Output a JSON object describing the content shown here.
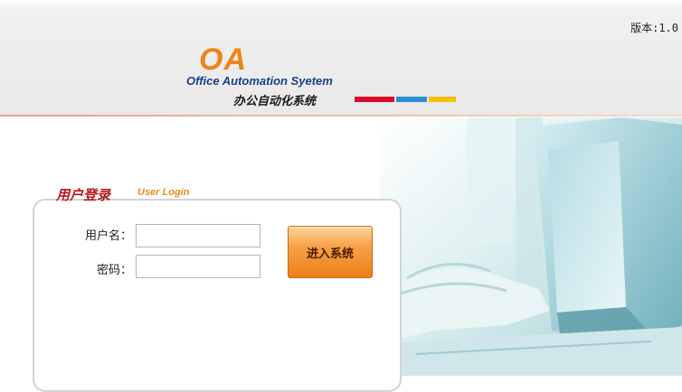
{
  "header": {
    "version_text": "版本:1.0",
    "logo": {
      "abbr": "OA",
      "english_name": "Office Automation Syetem",
      "chinese_name": "办公自动化系统"
    }
  },
  "login": {
    "title": "用户登录",
    "subtitle": "User Login",
    "username_label": "用户名：",
    "username_value": "",
    "password_label": "密码：",
    "password_value": "",
    "submit_label": "进入系统"
  },
  "colors": {
    "logo_orange": "#ef8318",
    "logo_blue": "#1b3f87",
    "brand_bar_red": "#d90b2b",
    "brand_bar_blue": "#2e8fd3",
    "brand_bar_yellow": "#f5c000",
    "title_red": "#b51a1a",
    "button_orange": "#ec7f1a"
  }
}
